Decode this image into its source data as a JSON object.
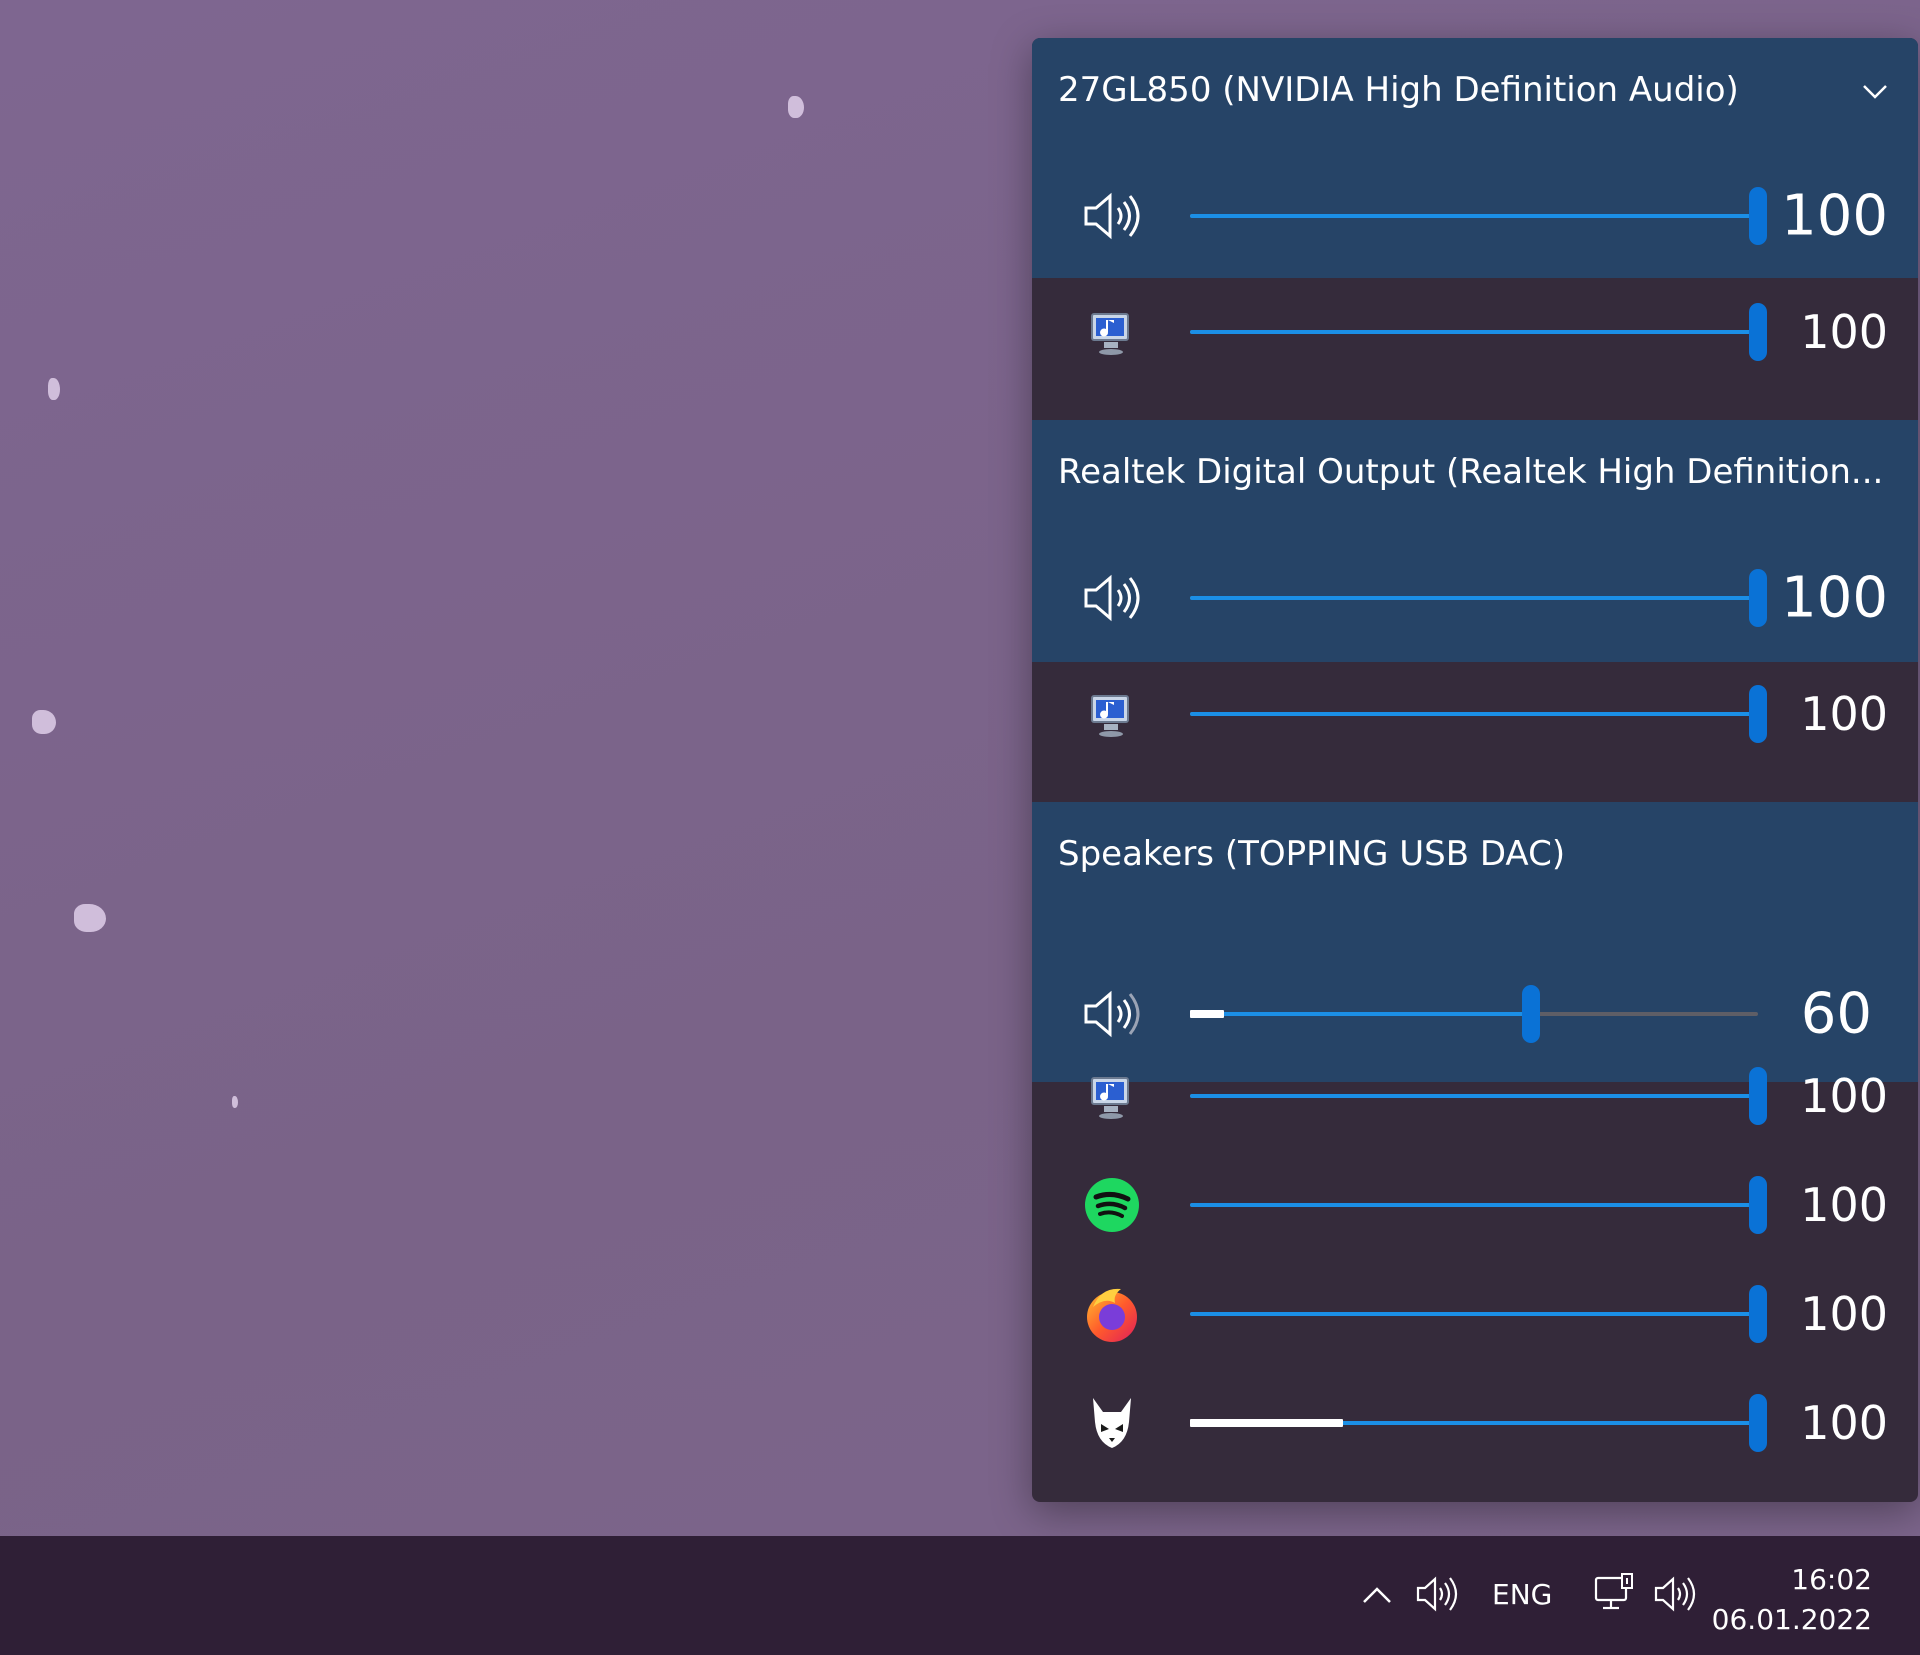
{
  "flyout": {
    "devices": [
      {
        "name": "27GL850 (NVIDIA High Definition Audio)",
        "has_chevron": true,
        "master": {
          "icon": "speaker-volume-icon",
          "value": "100",
          "level": 1.0,
          "peak": 0
        },
        "apps": [
          {
            "icon": "system-sounds-icon",
            "value": "100",
            "level": 1.0,
            "peak": 0
          }
        ]
      },
      {
        "name": "Realtek Digital Output (Realtek High Definition...",
        "has_chevron": false,
        "master": {
          "icon": "speaker-volume-icon",
          "value": "100",
          "level": 1.0,
          "peak": 0
        },
        "apps": [
          {
            "icon": "system-sounds-icon",
            "value": "100",
            "level": 1.0,
            "peak": 0
          }
        ]
      },
      {
        "name": "Speakers (TOPPING USB DAC)",
        "has_chevron": false,
        "master": {
          "icon": "speaker-volume-icon",
          "value": "60",
          "level": 0.6,
          "peak": 0.06
        },
        "apps": [
          {
            "icon": "system-sounds-icon",
            "value": "100",
            "level": 1.0,
            "peak": 0
          },
          {
            "icon": "spotify-icon",
            "value": "100",
            "level": 1.0,
            "peak": 0
          },
          {
            "icon": "firefox-icon",
            "value": "100",
            "level": 1.0,
            "peak": 0
          },
          {
            "icon": "foobar-icon",
            "value": "100",
            "level": 1.0,
            "peak": 0.27
          }
        ]
      }
    ]
  },
  "taskbar": {
    "language": "ENG",
    "time": "16:02",
    "date": "06.01.2022",
    "icons": [
      "chevron-up-icon",
      "speaker-icon",
      "network-icon",
      "volume-icon"
    ]
  },
  "colors": {
    "desktop": "#7b6489",
    "device_header": "#264467",
    "app_rows": "#352b3b",
    "accent": "#0a72d6",
    "taskbar": "#2f1f36"
  }
}
